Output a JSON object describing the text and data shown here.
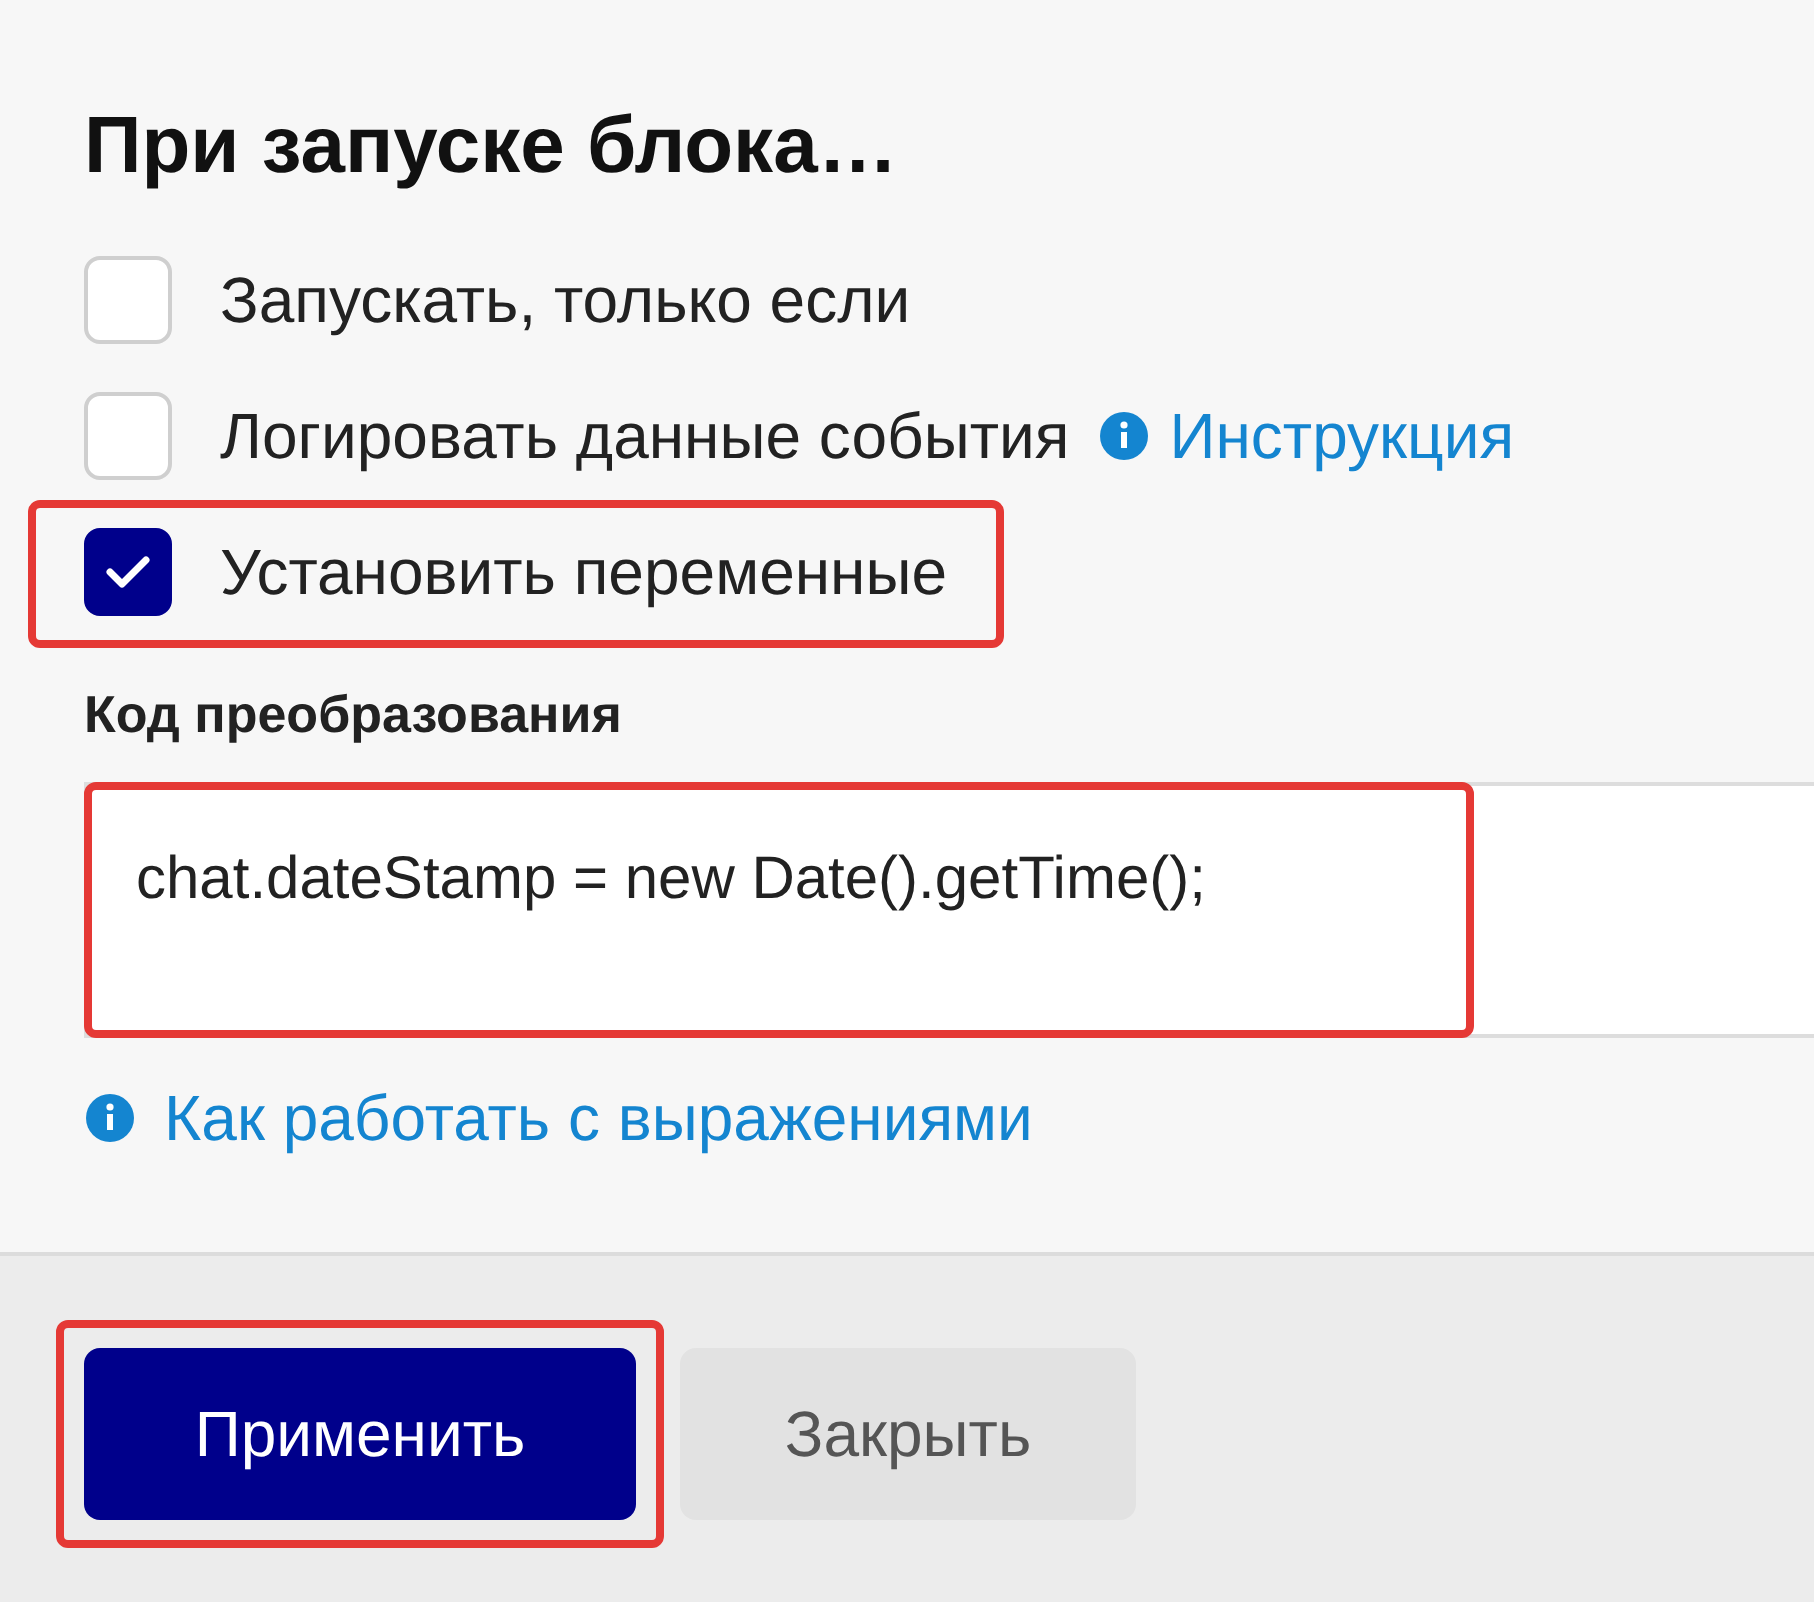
{
  "title": "При запуске блока…",
  "options": [
    {
      "label": "Запускать, только если",
      "checked": false,
      "highlighted": false
    },
    {
      "label": "Логировать данные события",
      "checked": false,
      "highlighted": false,
      "link": "Инструкция"
    },
    {
      "label": "Установить переменные",
      "checked": true,
      "highlighted": true
    }
  ],
  "code_field": {
    "label": "Код преобразования",
    "value": "chat.dateStamp = new Date().getTime();",
    "highlighted": true
  },
  "help_link": "Как работать с выражениями",
  "buttons": [
    {
      "label": "Применить",
      "kind": "primary",
      "highlighted": true
    },
    {
      "label": "Закрыть",
      "kind": "secondary",
      "highlighted": false
    }
  ]
}
